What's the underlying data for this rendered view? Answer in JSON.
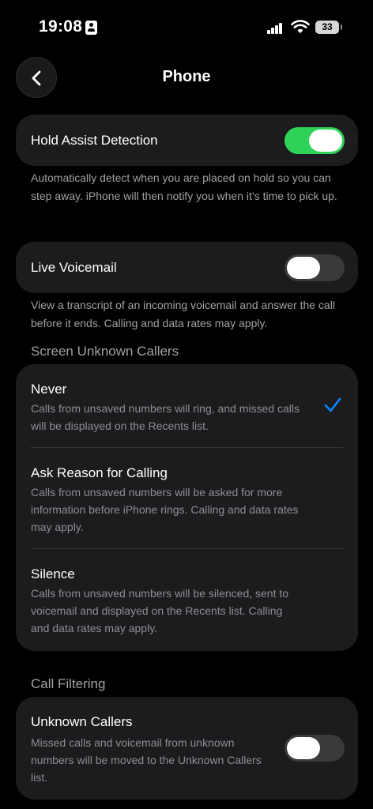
{
  "status_bar": {
    "time": "19:08",
    "battery": "33"
  },
  "nav": {
    "title": "Phone"
  },
  "hold_assist": {
    "label": "Hold Assist Detection",
    "enabled": true,
    "footnote": "Automatically detect when you are placed on hold so you can step away. iPhone will then notify you when it’s time to pick up."
  },
  "live_voicemail": {
    "label": "Live Voicemail",
    "enabled": false,
    "footnote": "View a transcript of an incoming voicemail and answer the call before it ends. Calling and data rates may apply."
  },
  "screen_unknown": {
    "header": "Screen Unknown Callers",
    "options": [
      {
        "title": "Never",
        "description": "Calls from unsaved numbers will ring, and missed calls will be displayed on the Recents list.",
        "selected": true
      },
      {
        "title": "Ask Reason for Calling",
        "description": "Calls from unsaved numbers will be asked for more information before iPhone rings. Calling and data rates may apply.",
        "selected": false
      },
      {
        "title": "Silence",
        "description": "Calls from unsaved numbers will be silenced, sent to voicemail and displayed on the Recents list. Calling and data rates may apply.",
        "selected": false
      }
    ]
  },
  "call_filtering": {
    "header": "Call Filtering",
    "unknown_callers": {
      "title": "Unknown Callers",
      "description": "Missed calls and voicemail from unknown numbers will be moved to the Unknown Callers list.",
      "enabled": false
    }
  },
  "colors": {
    "accent": "#0a84ff",
    "toggle_on": "#30d158",
    "card": "#1c1c1e"
  }
}
